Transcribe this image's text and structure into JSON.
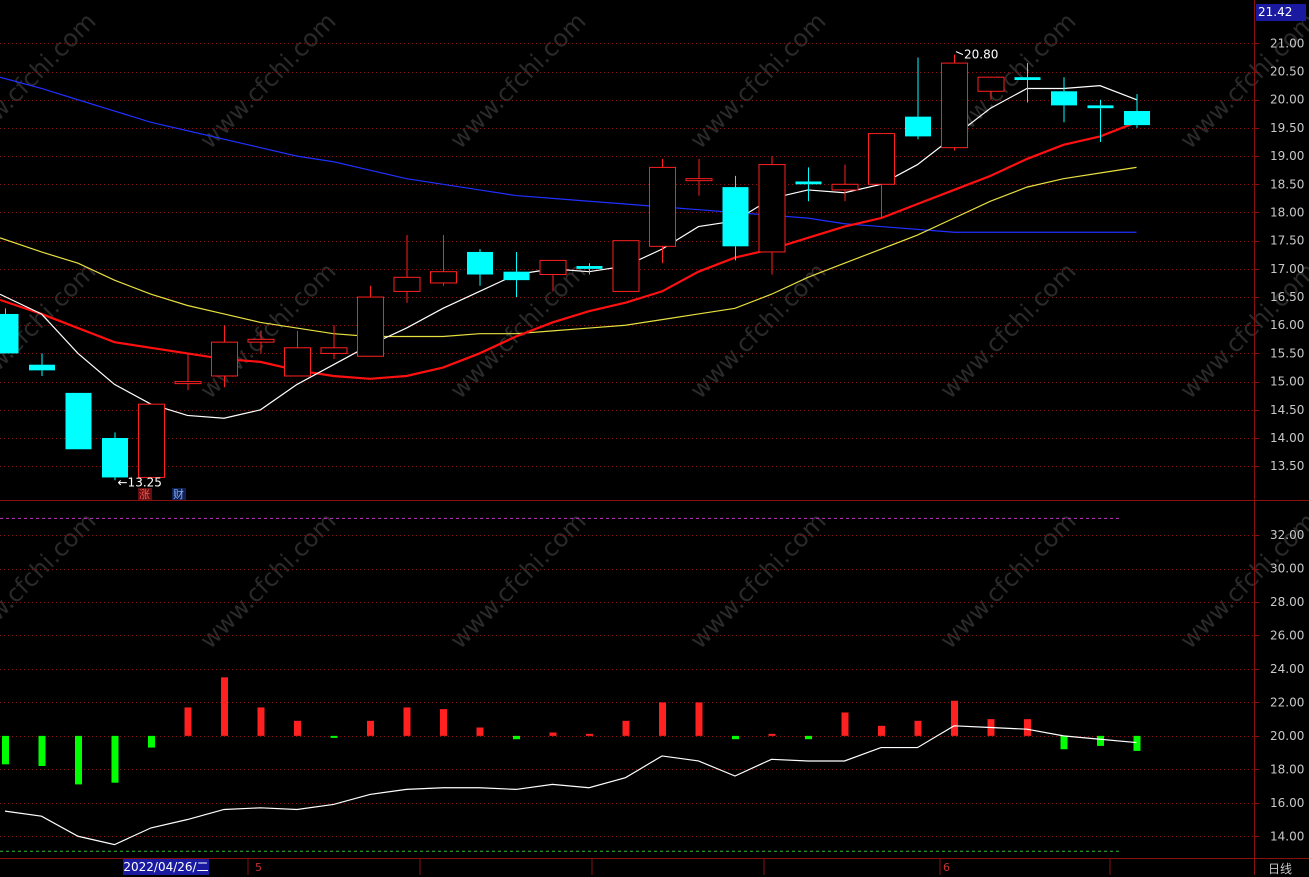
{
  "header": {
    "last_price": "21.42"
  },
  "footer": {
    "date": "2022/04/26/二",
    "month_5": "5",
    "month_6": "6",
    "period": "日线"
  },
  "colors": {
    "up": "#ff2020",
    "down": "#00ffff",
    "vol_down": "#00ff00",
    "ma5": "#ffffff",
    "ma10": "#ff1010",
    "ma20": "#e8e040",
    "ma60": "#2030ff",
    "grid": "#8a1010"
  },
  "chart_data": [
    {
      "type": "candlestick",
      "ylim": [
        12.9,
        21.45
      ],
      "yticks": [
        "21.00",
        "20.50",
        "20.00",
        "19.50",
        "19.00",
        "18.50",
        "18.00",
        "17.50",
        "17.00",
        "16.50",
        "16.00",
        "15.50",
        "15.00",
        "14.50",
        "14.00",
        "13.50"
      ],
      "annotations": {
        "low_label": "13.25",
        "high_label": "20.80",
        "tag_zhang": "涨",
        "tag_cai": "财"
      },
      "candles": [
        {
          "o": 16.2,
          "h": 16.3,
          "l": 15.5,
          "c": 15.5
        },
        {
          "o": 15.3,
          "h": 15.5,
          "l": 15.1,
          "c": 15.2
        },
        {
          "o": 14.8,
          "h": 14.8,
          "l": 13.8,
          "c": 13.8
        },
        {
          "o": 14.0,
          "h": 14.1,
          "l": 13.25,
          "c": 13.3
        },
        {
          "o": 13.3,
          "h": 14.6,
          "l": 13.3,
          "c": 14.6
        },
        {
          "o": 15.0,
          "h": 15.5,
          "l": 14.85,
          "c": 15.0
        },
        {
          "o": 15.1,
          "h": 16.0,
          "l": 14.9,
          "c": 15.7
        },
        {
          "o": 15.7,
          "h": 15.9,
          "l": 15.5,
          "c": 15.75
        },
        {
          "o": 15.1,
          "h": 15.9,
          "l": 15.1,
          "c": 15.6
        },
        {
          "o": 15.5,
          "h": 16.0,
          "l": 15.4,
          "c": 15.6
        },
        {
          "o": 15.45,
          "h": 16.7,
          "l": 15.45,
          "c": 16.5
        },
        {
          "o": 16.6,
          "h": 17.6,
          "l": 16.4,
          "c": 16.85
        },
        {
          "o": 16.75,
          "h": 17.6,
          "l": 16.7,
          "c": 16.95
        },
        {
          "o": 17.3,
          "h": 17.35,
          "l": 16.7,
          "c": 16.9
        },
        {
          "o": 16.95,
          "h": 17.3,
          "l": 16.5,
          "c": 16.8
        },
        {
          "o": 16.9,
          "h": 17.15,
          "l": 16.6,
          "c": 17.15
        },
        {
          "o": 17.05,
          "h": 17.1,
          "l": 16.9,
          "c": 17.0
        },
        {
          "o": 16.6,
          "h": 17.5,
          "l": 16.6,
          "c": 17.5
        },
        {
          "o": 17.4,
          "h": 18.95,
          "l": 17.1,
          "c": 18.8
        },
        {
          "o": 18.6,
          "h": 18.95,
          "l": 18.3,
          "c": 18.6
        },
        {
          "o": 18.45,
          "h": 18.65,
          "l": 17.15,
          "c": 17.4
        },
        {
          "o": 17.3,
          "h": 19.0,
          "l": 16.9,
          "c": 18.85
        },
        {
          "o": 18.55,
          "h": 18.8,
          "l": 18.2,
          "c": 18.5
        },
        {
          "o": 18.4,
          "h": 18.85,
          "l": 18.2,
          "c": 18.5
        },
        {
          "o": 18.5,
          "h": 19.4,
          "l": 17.9,
          "c": 19.4
        },
        {
          "o": 19.7,
          "h": 20.75,
          "l": 19.3,
          "c": 19.35
        },
        {
          "o": 19.15,
          "h": 20.8,
          "l": 19.1,
          "c": 20.65
        },
        {
          "o": 20.15,
          "h": 20.4,
          "l": 20.0,
          "c": 20.4
        },
        {
          "o": 20.4,
          "h": 20.65,
          "l": 19.95,
          "c": 20.35
        },
        {
          "o": 20.15,
          "h": 20.4,
          "l": 19.6,
          "c": 19.9
        },
        {
          "o": 19.9,
          "h": 20.0,
          "l": 19.25,
          "c": 19.85
        },
        {
          "o": 19.8,
          "h": 20.1,
          "l": 19.5,
          "c": 19.55
        }
      ],
      "ma5": [
        16.55,
        16.2,
        15.5,
        14.95,
        14.6,
        14.4,
        14.35,
        14.5,
        14.95,
        15.3,
        15.65,
        15.95,
        16.3,
        16.6,
        16.9,
        17.0,
        16.95,
        17.05,
        17.35,
        17.75,
        17.85,
        18.25,
        18.4,
        18.35,
        18.5,
        18.85,
        19.35,
        19.85,
        20.2,
        20.2,
        20.25,
        20.0
      ],
      "ma10": [
        16.45,
        16.2,
        15.95,
        15.7,
        15.6,
        15.5,
        15.4,
        15.35,
        15.2,
        15.1,
        15.05,
        15.1,
        15.25,
        15.5,
        15.8,
        16.05,
        16.25,
        16.4,
        16.6,
        16.95,
        17.2,
        17.35,
        17.55,
        17.75,
        17.9,
        18.15,
        18.4,
        18.65,
        18.95,
        19.2,
        19.35,
        19.6
      ],
      "ma20": [
        17.55,
        17.3,
        17.1,
        16.8,
        16.55,
        16.35,
        16.2,
        16.05,
        15.95,
        15.85,
        15.8,
        15.8,
        15.8,
        15.85,
        15.85,
        15.9,
        15.95,
        16.0,
        16.1,
        16.2,
        16.3,
        16.55,
        16.85,
        17.1,
        17.35,
        17.6,
        17.9,
        18.2,
        18.45,
        18.6,
        18.7,
        18.8
      ],
      "ma60": [
        20.4,
        20.2,
        20.0,
        19.8,
        19.6,
        19.45,
        19.3,
        19.15,
        19.0,
        18.9,
        18.75,
        18.6,
        18.5,
        18.4,
        18.3,
        18.25,
        18.2,
        18.15,
        18.1,
        18.05,
        18.0,
        17.95,
        17.9,
        17.8,
        17.75,
        17.7,
        17.65,
        17.65,
        17.65,
        17.65,
        17.65,
        17.65
      ]
    },
    {
      "type": "bar+line",
      "ylim": [
        12.7,
        33.8
      ],
      "yticks": [
        "32.00",
        "30.00",
        "28.00",
        "26.00",
        "24.00",
        "22.00",
        "20.00",
        "18.00",
        "16.00",
        "14.00"
      ],
      "base": 20.0,
      "bars": [
        18.3,
        18.2,
        17.1,
        17.2,
        19.3,
        21.7,
        23.5,
        21.7,
        20.9,
        19.9,
        20.9,
        21.7,
        21.6,
        20.5,
        19.8,
        20.2,
        20.1,
        20.9,
        22.0,
        22.0,
        19.8,
        20.1,
        19.8,
        21.4,
        20.6,
        20.9,
        22.1,
        21.0,
        21.0,
        19.2,
        19.4,
        19.1
      ],
      "line": [
        15.5,
        15.2,
        14.0,
        13.5,
        14.5,
        15.0,
        15.6,
        15.7,
        15.6,
        15.9,
        16.5,
        16.8,
        16.9,
        16.9,
        16.8,
        17.1,
        16.9,
        17.5,
        18.8,
        18.5,
        17.6,
        18.6,
        18.5,
        18.5,
        19.3,
        19.3,
        20.6,
        20.5,
        20.4,
        20.0,
        19.8,
        19.6
      ],
      "dashed_levels": [
        33.0,
        13.1
      ]
    }
  ]
}
